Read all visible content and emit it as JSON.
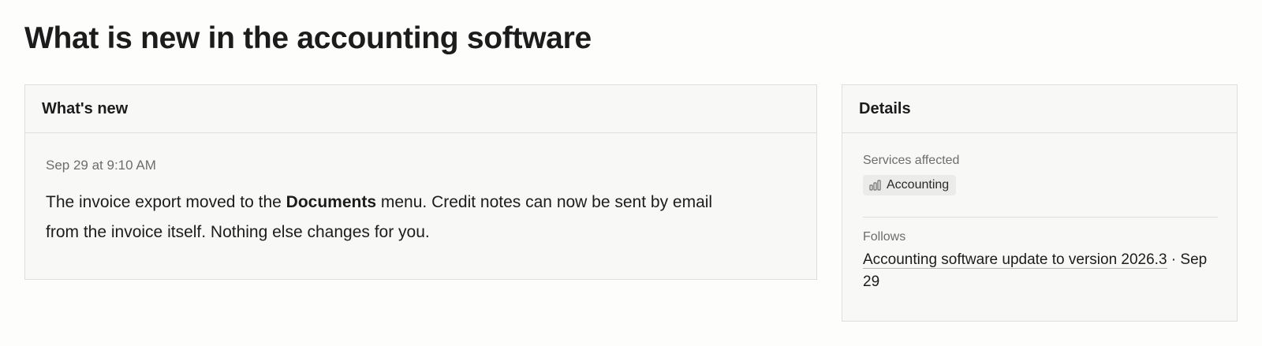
{
  "page": {
    "title": "What is new in the accounting software"
  },
  "whats_new": {
    "header": "What's new",
    "timestamp": "Sep 29 at 9:10 AM",
    "body": {
      "part1": "The invoice export moved to the ",
      "emphasis": "Documents",
      "part2": " menu. Credit notes can now be sent by email from the invoice itself. Nothing else changes for you."
    }
  },
  "details": {
    "header": "Details",
    "services_label": "Services affected",
    "services": [
      {
        "name": "Accounting",
        "icon": "bar-chart-icon"
      }
    ],
    "follows_label": "Follows",
    "follows": {
      "link_text": "Accounting software update to version 2026.3",
      "separator": " · ",
      "date": "Sep 29"
    }
  },
  "colors": {
    "background": "#fdfdfc",
    "card_background": "#f8f8f7",
    "border": "#dededc",
    "text_primary": "#1c1c1c",
    "text_muted": "#6d6d6b",
    "chip_background": "#ebebea"
  }
}
